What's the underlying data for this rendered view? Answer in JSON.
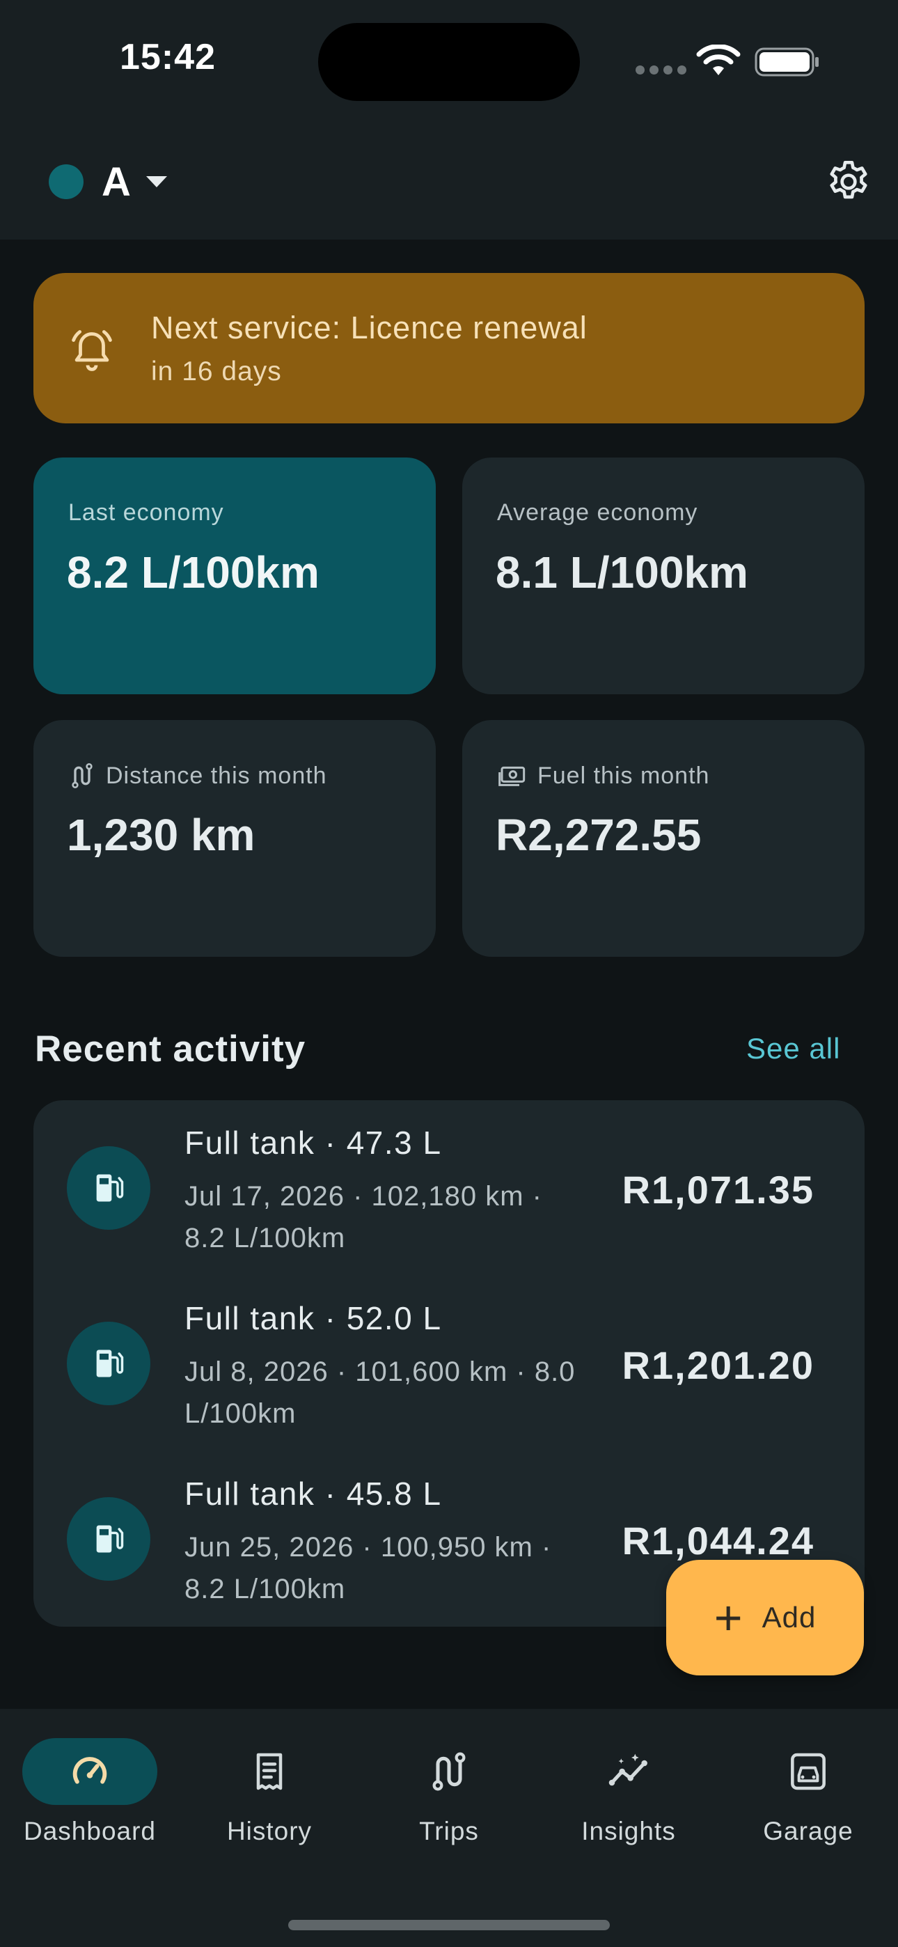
{
  "status_bar": {
    "time": "15:42"
  },
  "header": {
    "vehicle_name": "A",
    "vehicle_color": "#0f6a72"
  },
  "banner": {
    "title": "Next service: Licence renewal",
    "subtitle": "in 16 days",
    "color": "#8b5d10"
  },
  "stats": {
    "last_economy": {
      "label": "Last economy",
      "value": "8.2 L/100km"
    },
    "average_economy": {
      "label": "Average economy",
      "value": "8.1 L/100km"
    },
    "distance_month": {
      "label": "Distance this month",
      "value": "1,230 km"
    },
    "fuel_month": {
      "label": "Fuel this month",
      "value": "R2,272.55"
    }
  },
  "recent": {
    "title": "Recent activity",
    "see_all": "See all",
    "items": [
      {
        "title": "Full tank · 47.3 L",
        "meta": "Jul 17, 2026 · 102,180 km · 8.2 L/100km",
        "amount": "R1,071.35"
      },
      {
        "title": "Full tank · 52.0 L",
        "meta": "Jul 8, 2026 · 101,600 km · 8.0 L/100km",
        "amount": "R1,201.20"
      },
      {
        "title": "Full tank · 45.8 L",
        "meta": "Jun 25, 2026 · 100,950 km · 8.2 L/100km",
        "amount": "R1,044.24"
      }
    ]
  },
  "fab": {
    "label": "Add"
  },
  "nav": {
    "items": [
      {
        "label": "Dashboard",
        "icon": "speedometer-icon",
        "active": true
      },
      {
        "label": "History",
        "icon": "receipt-icon",
        "active": false
      },
      {
        "label": "Trips",
        "icon": "route-icon",
        "active": false
      },
      {
        "label": "Insights",
        "icon": "insights-icon",
        "active": false
      },
      {
        "label": "Garage",
        "icon": "car-icon",
        "active": false
      }
    ]
  },
  "colors": {
    "accent": "#59c6d3",
    "fab": "#ffb74d",
    "primary_card": "#0a5660",
    "surface": "#1d272b"
  }
}
